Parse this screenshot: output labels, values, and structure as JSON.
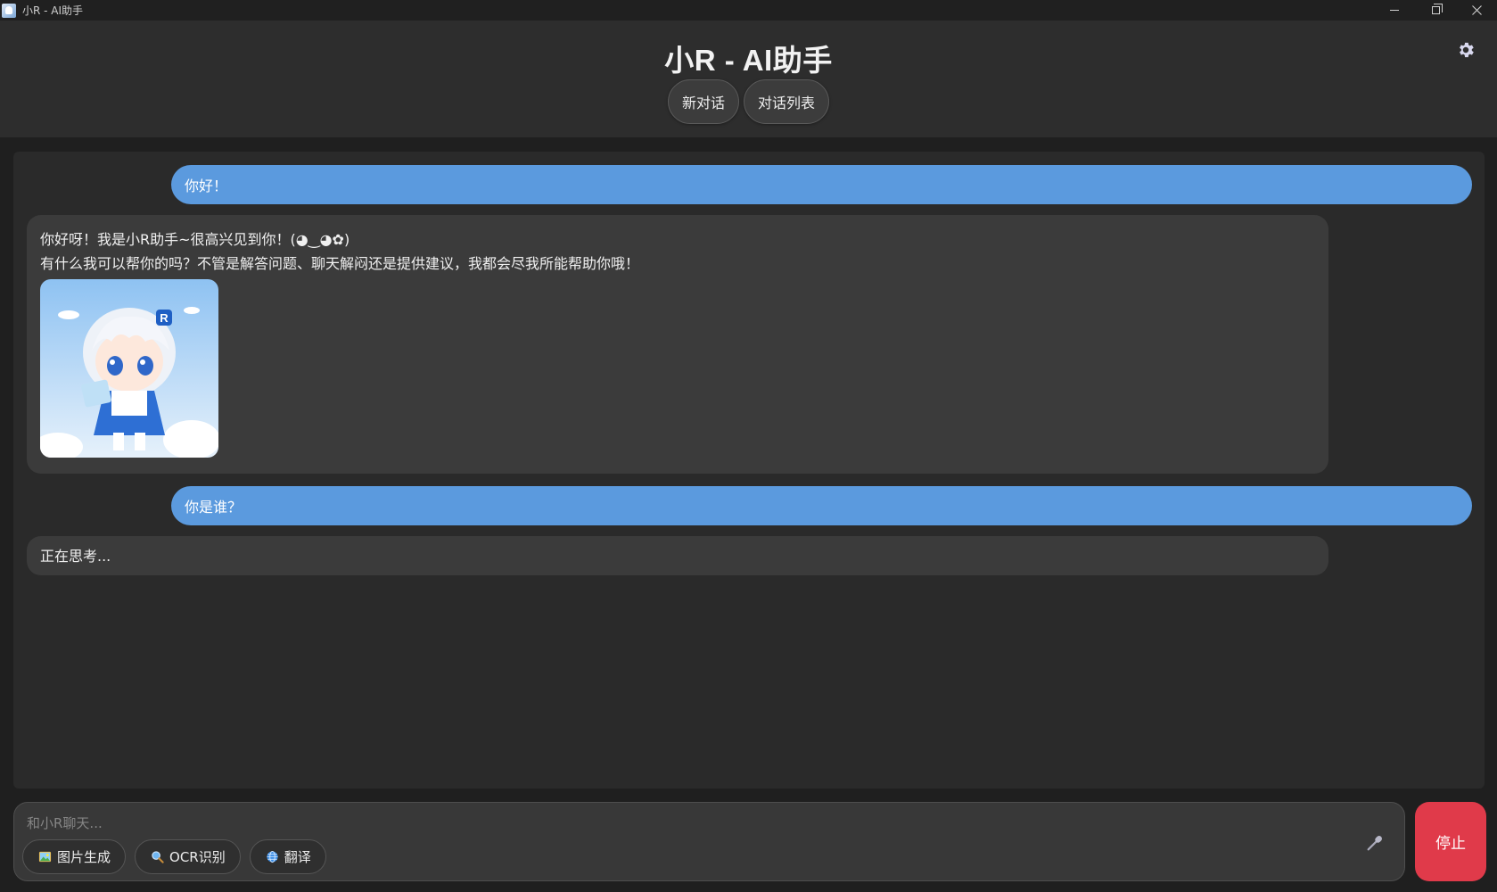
{
  "window": {
    "title": "小R - AI助手"
  },
  "header": {
    "title": "小R - AI助手",
    "new_chat_label": "新对话",
    "chat_list_label": "对话列表",
    "settings_icon": "gear-icon"
  },
  "messages": [
    {
      "role": "user",
      "text": "你好！"
    },
    {
      "role": "assistant",
      "line1": "你好呀！我是小R助手~很高兴见到你！(◕‿◕✿)",
      "line2": "有什么我可以帮你的吗？不管是解答问题、聊天解闷还是提供建议，我都会尽我所能帮助你哦！",
      "image_badge": "R"
    },
    {
      "role": "user",
      "text": "你是谁？"
    },
    {
      "role": "assistant",
      "text": "正在思考..."
    }
  ],
  "input": {
    "placeholder": "和小R聊天...",
    "value": "",
    "mic_icon": "microphone-icon"
  },
  "tools": [
    {
      "label": "图片生成",
      "icon": "image-icon"
    },
    {
      "label": "OCR识别",
      "icon": "magnifier-icon"
    },
    {
      "label": "翻译",
      "icon": "globe-icon"
    }
  ],
  "stop_label": "停止",
  "colors": {
    "user_bubble": "#5b9ade",
    "ai_bubble": "#3b3b3b",
    "stop_button": "#e03a4a",
    "background": "#2a2a2a"
  }
}
